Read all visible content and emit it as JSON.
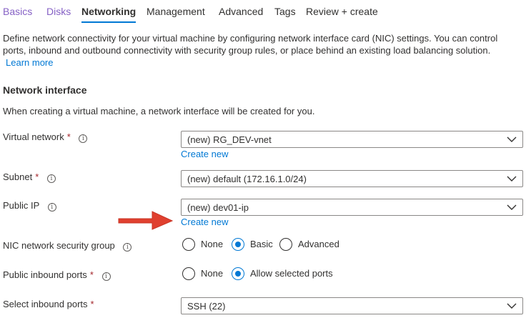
{
  "tabs": [
    {
      "label": "Basics",
      "state": "visited"
    },
    {
      "label": "Disks",
      "state": "visited"
    },
    {
      "label": "Networking",
      "state": "active"
    },
    {
      "label": "Management",
      "state": "normal"
    },
    {
      "label": "Advanced",
      "state": "normal"
    },
    {
      "label": "Tags",
      "state": "normal"
    },
    {
      "label": "Review + create",
      "state": "normal"
    }
  ],
  "description": {
    "line1": "Define network connectivity for your virtual machine by configuring network interface card (NIC) settings. You can control",
    "line2": "ports, inbound and outbound connectivity with security group rules, or place behind an existing load balancing solution.",
    "learn_more": "Learn more"
  },
  "section": {
    "title": "Network interface",
    "subtitle": "When creating a virtual machine, a network interface will be created for you."
  },
  "fields": {
    "virtual_network": {
      "label": "Virtual network",
      "required": "*",
      "value": "(new) RG_DEV-vnet",
      "create_new": "Create new"
    },
    "subnet": {
      "label": "Subnet",
      "required": "*",
      "value": "(new) default (172.16.1.0/24)"
    },
    "public_ip": {
      "label": "Public IP",
      "value": "(new) dev01-ip",
      "create_new": "Create new"
    },
    "nic_nsg": {
      "label": "NIC network security group",
      "options": [
        "None",
        "Basic",
        "Advanced"
      ],
      "selected": "Basic"
    },
    "public_inbound_ports": {
      "label": "Public inbound ports",
      "required": "*",
      "options": [
        "None",
        "Allow selected ports"
      ],
      "selected": "Allow selected ports"
    },
    "select_inbound_ports": {
      "label": "Select inbound ports",
      "required": "*",
      "value": "SSH (22)"
    }
  },
  "icons": {
    "info": "info-icon",
    "chevron": "chevron-down-icon",
    "annotation": "red-arrow"
  },
  "colors": {
    "accent": "#0078d4",
    "visited": "#8661c5",
    "required": "#a4262c",
    "arrow": "#e0402f"
  }
}
